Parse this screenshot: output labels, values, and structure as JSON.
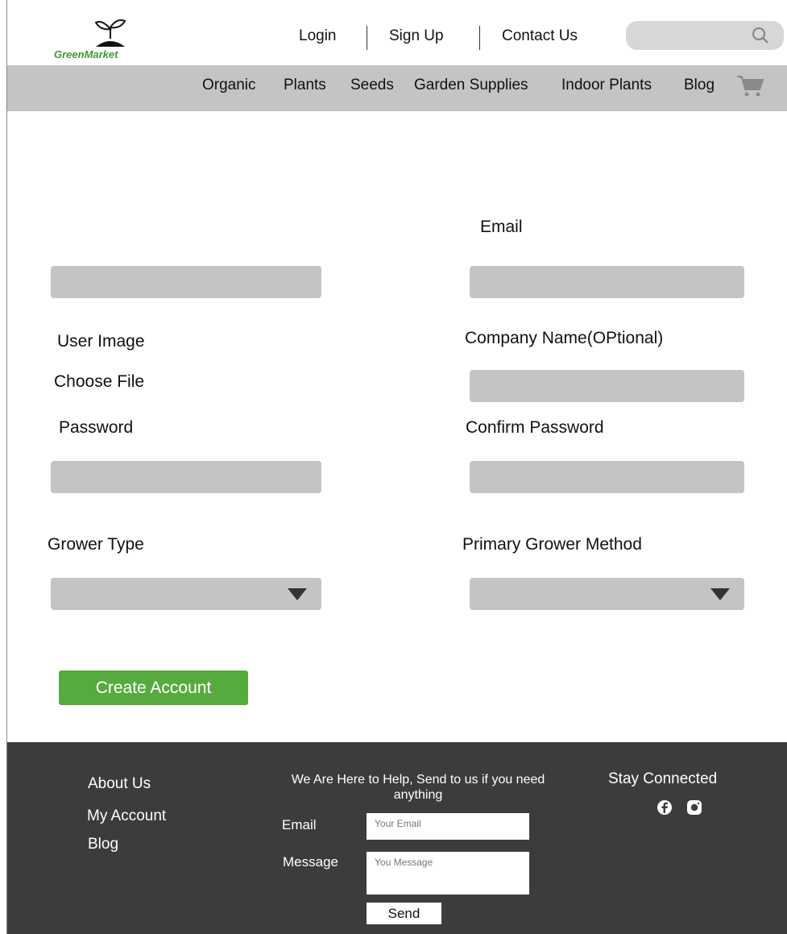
{
  "brand": {
    "name": "GreenMarket",
    "color": "#3f9b32"
  },
  "header": {
    "links": [
      "Login",
      "Sign Up",
      "Contact Us"
    ],
    "search_icon": "search-icon"
  },
  "nav": {
    "items": [
      "Organic",
      "Plants",
      "Seeds",
      "Garden Supplies",
      "Indoor Plants",
      "Blog"
    ],
    "cart_icon": "shopping-cart-icon"
  },
  "form": {
    "email_label": "Email",
    "user_image_label": "User Image",
    "choose_file_label": "Choose File",
    "company_label": "Company Name(OPtional)",
    "password_label": "Password",
    "confirm_password_label": "Confirm Password",
    "grower_type_label": "Grower Type",
    "grower_method_label": "Primary Grower Method",
    "submit_label": "Create Account",
    "accent_color": "#57ab3e"
  },
  "footer": {
    "links": [
      "About Us",
      "My Account",
      "Blog"
    ],
    "help_text": "We Are Here to Help, Send to us if you need anything",
    "email_label": "Email",
    "email_placeholder": "Your Email",
    "message_label": "Message",
    "message_placeholder": "You Message",
    "send_label": "Send",
    "stay_connected": "Stay Connected",
    "social_icons": [
      "facebook-icon",
      "instagram-icon"
    ]
  }
}
